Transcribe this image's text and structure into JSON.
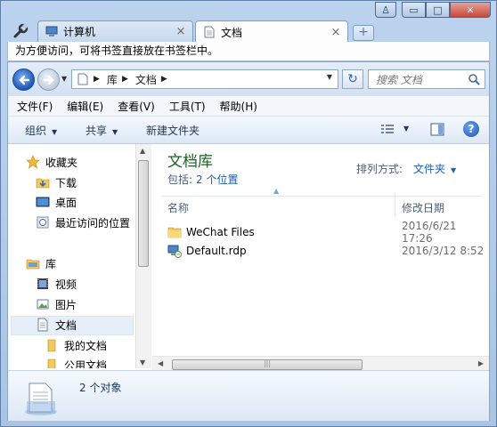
{
  "window": {
    "tabs": [
      {
        "label": "计算机",
        "close": "×"
      },
      {
        "label": "文档",
        "close": "×"
      }
    ],
    "new_tab": "+",
    "caption": {
      "user": "♙",
      "minimize": "▭",
      "maximize": "□",
      "close": "✕"
    }
  },
  "bookmark_bar": {
    "text": "为方便访问，可将书签直接放在书签栏中。"
  },
  "address": {
    "crumbs": [
      "库",
      "文档"
    ],
    "refresh": "↻",
    "search_placeholder": "搜索 文档"
  },
  "menu": [
    "文件(F)",
    "编辑(E)",
    "查看(V)",
    "工具(T)",
    "帮助(H)"
  ],
  "commands": {
    "organize": "组织",
    "share": "共享",
    "new_folder": "新建文件夹",
    "help": "?"
  },
  "nav_pane": {
    "favorites": "收藏夹",
    "downloads": "下载",
    "desktop": "桌面",
    "recent": "最近访问的位置",
    "libraries": "库",
    "videos": "视频",
    "pictures": "图片",
    "documents": "文档",
    "my_documents": "我的文档",
    "public_documents": "公用文档"
  },
  "library": {
    "title": "文档库",
    "includes_label": "包括:",
    "includes_link": "2 个位置",
    "arrange_label": "排列方式:",
    "arrange_value": "文件夹"
  },
  "columns": {
    "name": "名称",
    "modified": "修改日期"
  },
  "files": [
    {
      "name": "WeChat Files",
      "date": "2016/6/21 17:26",
      "icon": "folder-icon"
    },
    {
      "name": "Default.rdp",
      "date": "2016/3/12 8:52",
      "icon": "rdp-file-icon"
    }
  ],
  "status": {
    "count": "2 个对象"
  },
  "colors": {
    "accent": "#1a5fb4",
    "title_green": "#1e5e24",
    "selection": "#e5eef9"
  }
}
